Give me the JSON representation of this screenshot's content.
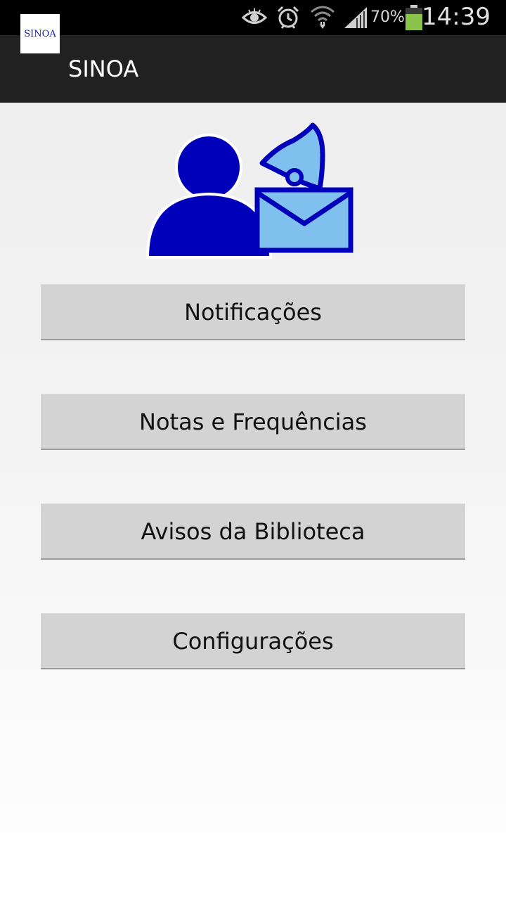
{
  "status_bar": {
    "icons": [
      "eye-icon",
      "alarm-icon",
      "wifi-icon",
      "signal-icon",
      "battery-icon"
    ],
    "battery_percent": "70%",
    "time": "14:39",
    "battery_color": "#8bc34a"
  },
  "action_bar": {
    "logo_text": "SINOA",
    "title": "SINOA"
  },
  "hero": {
    "icon": "user-notification-icon",
    "colors": {
      "person": "#0000bb",
      "accent": "#80c0ee"
    }
  },
  "menu": {
    "notifications_label": "Notificações",
    "grades_label": "Notas e Frequências",
    "library_label": "Avisos da Biblioteca",
    "settings_label": "Configurações"
  }
}
